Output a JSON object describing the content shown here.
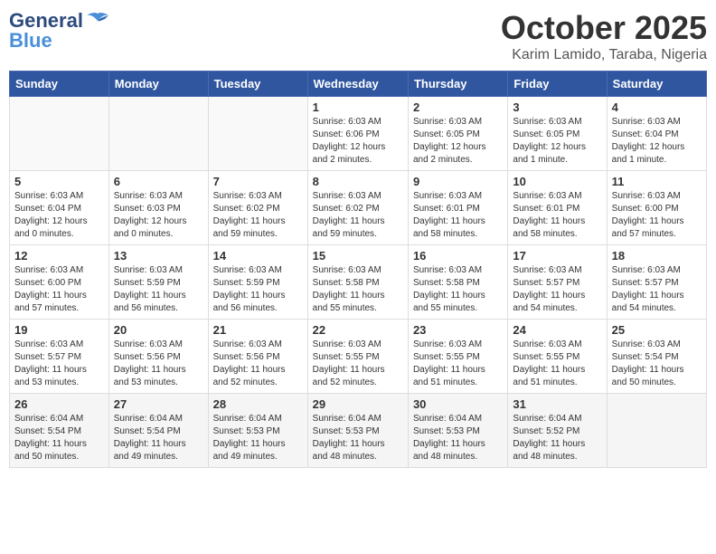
{
  "header": {
    "logo_general": "General",
    "logo_blue": "Blue",
    "month_year": "October 2025",
    "location": "Karim Lamido, Taraba, Nigeria"
  },
  "days_of_week": [
    "Sunday",
    "Monday",
    "Tuesday",
    "Wednesday",
    "Thursday",
    "Friday",
    "Saturday"
  ],
  "weeks": [
    [
      {
        "day": "",
        "info": ""
      },
      {
        "day": "",
        "info": ""
      },
      {
        "day": "",
        "info": ""
      },
      {
        "day": "1",
        "info": "Sunrise: 6:03 AM\nSunset: 6:06 PM\nDaylight: 12 hours\nand 2 minutes."
      },
      {
        "day": "2",
        "info": "Sunrise: 6:03 AM\nSunset: 6:05 PM\nDaylight: 12 hours\nand 2 minutes."
      },
      {
        "day": "3",
        "info": "Sunrise: 6:03 AM\nSunset: 6:05 PM\nDaylight: 12 hours\nand 1 minute."
      },
      {
        "day": "4",
        "info": "Sunrise: 6:03 AM\nSunset: 6:04 PM\nDaylight: 12 hours\nand 1 minute."
      }
    ],
    [
      {
        "day": "5",
        "info": "Sunrise: 6:03 AM\nSunset: 6:04 PM\nDaylight: 12 hours\nand 0 minutes."
      },
      {
        "day": "6",
        "info": "Sunrise: 6:03 AM\nSunset: 6:03 PM\nDaylight: 12 hours\nand 0 minutes."
      },
      {
        "day": "7",
        "info": "Sunrise: 6:03 AM\nSunset: 6:02 PM\nDaylight: 11 hours\nand 59 minutes."
      },
      {
        "day": "8",
        "info": "Sunrise: 6:03 AM\nSunset: 6:02 PM\nDaylight: 11 hours\nand 59 minutes."
      },
      {
        "day": "9",
        "info": "Sunrise: 6:03 AM\nSunset: 6:01 PM\nDaylight: 11 hours\nand 58 minutes."
      },
      {
        "day": "10",
        "info": "Sunrise: 6:03 AM\nSunset: 6:01 PM\nDaylight: 11 hours\nand 58 minutes."
      },
      {
        "day": "11",
        "info": "Sunrise: 6:03 AM\nSunset: 6:00 PM\nDaylight: 11 hours\nand 57 minutes."
      }
    ],
    [
      {
        "day": "12",
        "info": "Sunrise: 6:03 AM\nSunset: 6:00 PM\nDaylight: 11 hours\nand 57 minutes."
      },
      {
        "day": "13",
        "info": "Sunrise: 6:03 AM\nSunset: 5:59 PM\nDaylight: 11 hours\nand 56 minutes."
      },
      {
        "day": "14",
        "info": "Sunrise: 6:03 AM\nSunset: 5:59 PM\nDaylight: 11 hours\nand 56 minutes."
      },
      {
        "day": "15",
        "info": "Sunrise: 6:03 AM\nSunset: 5:58 PM\nDaylight: 11 hours\nand 55 minutes."
      },
      {
        "day": "16",
        "info": "Sunrise: 6:03 AM\nSunset: 5:58 PM\nDaylight: 11 hours\nand 55 minutes."
      },
      {
        "day": "17",
        "info": "Sunrise: 6:03 AM\nSunset: 5:57 PM\nDaylight: 11 hours\nand 54 minutes."
      },
      {
        "day": "18",
        "info": "Sunrise: 6:03 AM\nSunset: 5:57 PM\nDaylight: 11 hours\nand 54 minutes."
      }
    ],
    [
      {
        "day": "19",
        "info": "Sunrise: 6:03 AM\nSunset: 5:57 PM\nDaylight: 11 hours\nand 53 minutes."
      },
      {
        "day": "20",
        "info": "Sunrise: 6:03 AM\nSunset: 5:56 PM\nDaylight: 11 hours\nand 53 minutes."
      },
      {
        "day": "21",
        "info": "Sunrise: 6:03 AM\nSunset: 5:56 PM\nDaylight: 11 hours\nand 52 minutes."
      },
      {
        "day": "22",
        "info": "Sunrise: 6:03 AM\nSunset: 5:55 PM\nDaylight: 11 hours\nand 52 minutes."
      },
      {
        "day": "23",
        "info": "Sunrise: 6:03 AM\nSunset: 5:55 PM\nDaylight: 11 hours\nand 51 minutes."
      },
      {
        "day": "24",
        "info": "Sunrise: 6:03 AM\nSunset: 5:55 PM\nDaylight: 11 hours\nand 51 minutes."
      },
      {
        "day": "25",
        "info": "Sunrise: 6:03 AM\nSunset: 5:54 PM\nDaylight: 11 hours\nand 50 minutes."
      }
    ],
    [
      {
        "day": "26",
        "info": "Sunrise: 6:04 AM\nSunset: 5:54 PM\nDaylight: 11 hours\nand 50 minutes."
      },
      {
        "day": "27",
        "info": "Sunrise: 6:04 AM\nSunset: 5:54 PM\nDaylight: 11 hours\nand 49 minutes."
      },
      {
        "day": "28",
        "info": "Sunrise: 6:04 AM\nSunset: 5:53 PM\nDaylight: 11 hours\nand 49 minutes."
      },
      {
        "day": "29",
        "info": "Sunrise: 6:04 AM\nSunset: 5:53 PM\nDaylight: 11 hours\nand 48 minutes."
      },
      {
        "day": "30",
        "info": "Sunrise: 6:04 AM\nSunset: 5:53 PM\nDaylight: 11 hours\nand 48 minutes."
      },
      {
        "day": "31",
        "info": "Sunrise: 6:04 AM\nSunset: 5:52 PM\nDaylight: 11 hours\nand 48 minutes."
      },
      {
        "day": "",
        "info": ""
      }
    ]
  ]
}
